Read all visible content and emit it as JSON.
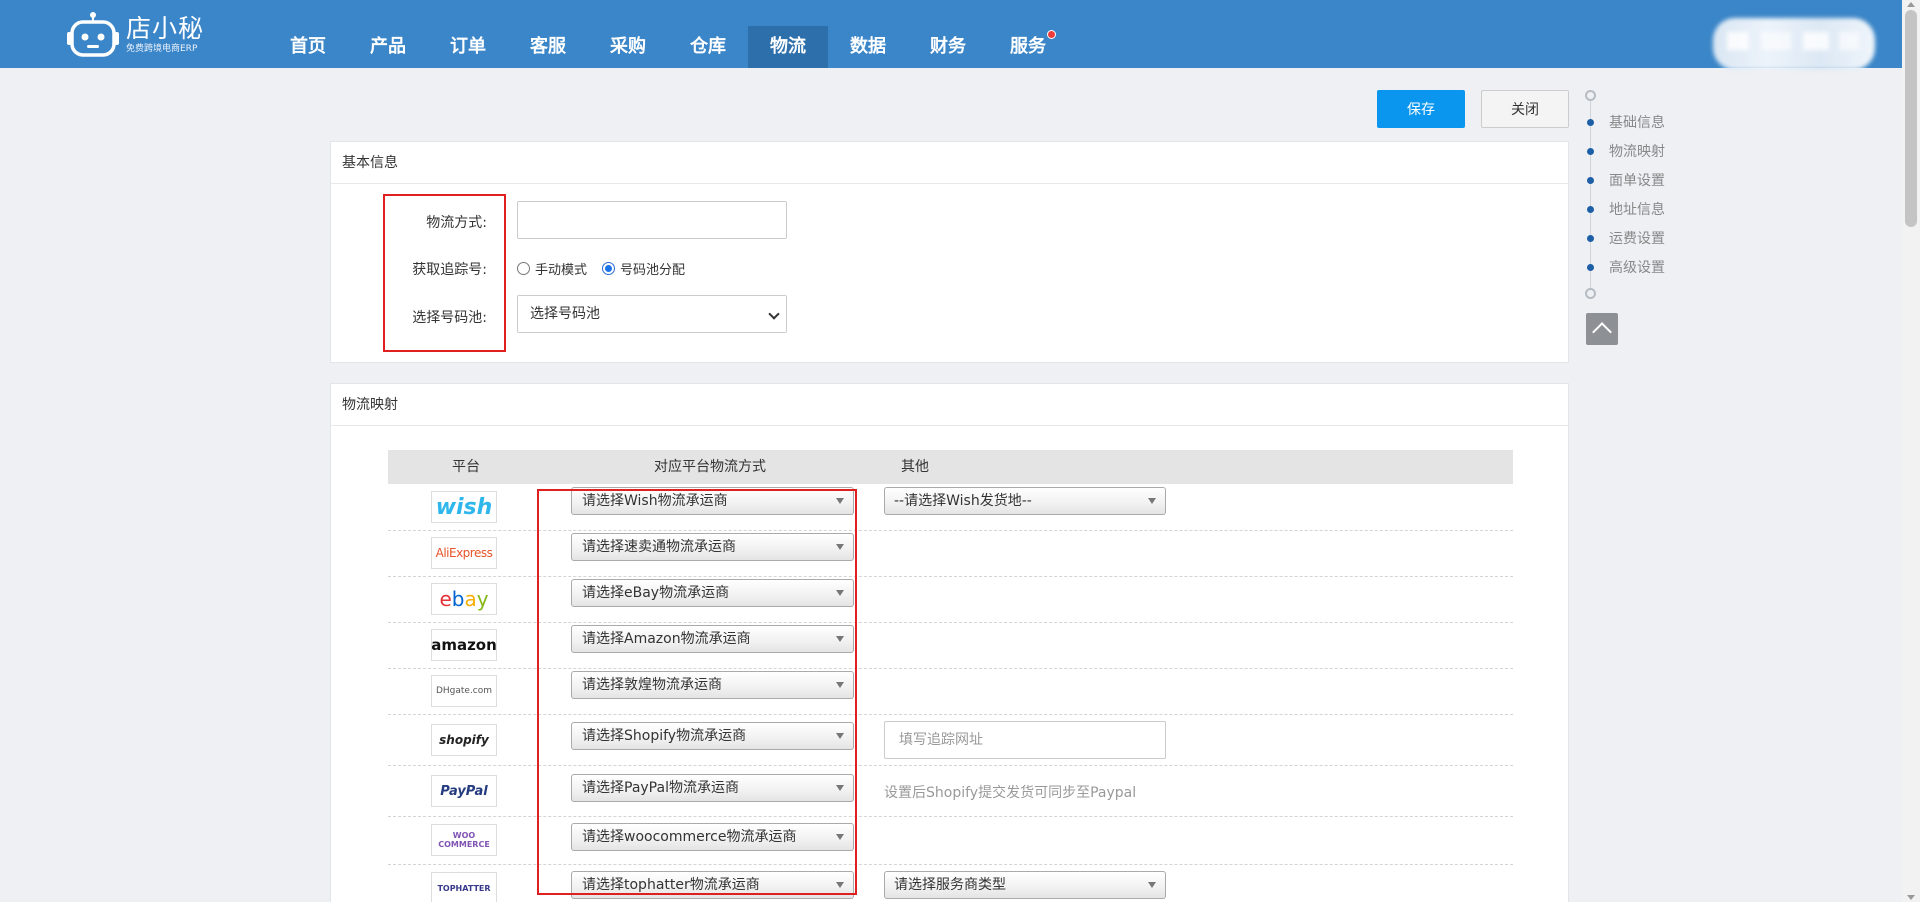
{
  "app": {
    "brand_name": "店小秘",
    "brand_sub": "免费跨境电商ERP"
  },
  "nav": {
    "items": [
      {
        "label": "首页",
        "active": false
      },
      {
        "label": "产品",
        "active": false
      },
      {
        "label": "订单",
        "active": false
      },
      {
        "label": "客服",
        "active": false
      },
      {
        "label": "采购",
        "active": false
      },
      {
        "label": "仓库",
        "active": false
      },
      {
        "label": "物流",
        "active": true
      },
      {
        "label": "数据",
        "active": false
      },
      {
        "label": "财务",
        "active": false
      },
      {
        "label": "服务",
        "active": false,
        "badge": true
      }
    ]
  },
  "toolbar": {
    "save_label": "保存",
    "close_label": "关闭"
  },
  "basic_info": {
    "title": "基本信息",
    "method_label": "物流方式:",
    "method_value": "",
    "tracking_label": "获取追踪号:",
    "tracking_options": [
      {
        "label": "手动模式",
        "selected": false
      },
      {
        "label": "号码池分配",
        "selected": true
      }
    ],
    "pool_label": "选择号码池:",
    "pool_value": "选择号码池"
  },
  "mapping": {
    "title": "物流映射",
    "headers": {
      "platform": "平台",
      "method": "对应平台物流方式",
      "other": "其他"
    },
    "rows": [
      {
        "platform": "wish",
        "logo_text": "wish",
        "select": "请选择Wish物流承运商",
        "other_select": "--请选择Wish发货地--"
      },
      {
        "platform": "aliexpress",
        "logo_text": "AliExpress",
        "select": "请选择速卖通物流承运商"
      },
      {
        "platform": "ebay",
        "logo_text": "ebay",
        "select": "请选择eBay物流承运商"
      },
      {
        "platform": "amazon",
        "logo_text": "amazon",
        "select": "请选择Amazon物流承运商"
      },
      {
        "platform": "dhgate",
        "logo_text": "DHgate.com",
        "select": "请选择敦煌物流承运商"
      },
      {
        "platform": "shopify",
        "logo_text": "shopify",
        "select": "请选择Shopify物流承运商",
        "other_placeholder": "填写追踪网址"
      },
      {
        "platform": "paypal",
        "logo_text": "PayPal",
        "select": "请选择PayPal物流承运商",
        "other_hint": "设置后Shopify提交发货可同步至Paypal"
      },
      {
        "platform": "woocommerce",
        "logo_text": "WOO COMMERCE",
        "select": "请选择woocommerce物流承运商"
      },
      {
        "platform": "tophatter",
        "logo_text": "TOPHATTER",
        "select": "请选择tophatter物流承运商",
        "other_select": "请选择服务商类型"
      }
    ]
  },
  "anchor_nav": {
    "items": [
      "基础信息",
      "物流映射",
      "面单设置",
      "地址信息",
      "运费设置",
      "高级设置"
    ]
  },
  "colors": {
    "header_bg": "#3b86c8",
    "nav_active_bg": "#2d6fab",
    "primary_button": "#0a95ee",
    "highlight_border": "#e02020",
    "anchor_dot": "#1d5fa6"
  },
  "icons": {
    "brand": "robot-logo-icon",
    "back_to_top": "chevron-up-icon",
    "badge": "notification-dot-icon"
  }
}
